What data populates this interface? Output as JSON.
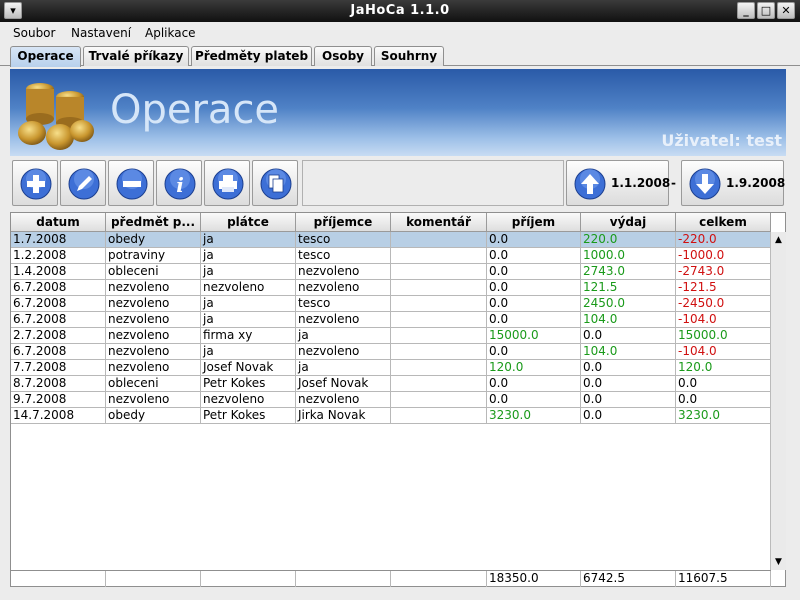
{
  "window": {
    "title": "JaHoCa 1.1.0"
  },
  "menu": [
    "Soubor",
    "Nastavení",
    "Aplikace"
  ],
  "tabs": [
    "Operace",
    "Trvalé příkazy",
    "Předměty plateb",
    "Osoby",
    "Souhrny"
  ],
  "banner": {
    "title": "Operace",
    "user": "Uživatel: test"
  },
  "toolbar": {
    "icons": [
      "plus-icon",
      "pencil-icon",
      "minus-icon",
      "info-icon",
      "printer-icon",
      "copy-icon"
    ],
    "date_from": "1.1.2008",
    "date_sep": "-",
    "date_to": "1.9.2008"
  },
  "table": {
    "columns": [
      "datum",
      "předmět p...",
      "plátce",
      "příjemce",
      "komentář",
      "příjem",
      "výdaj",
      "celkem"
    ],
    "rows": [
      [
        "1.7.2008",
        "obedy",
        "ja",
        "tesco",
        "",
        "0.0",
        "220.0",
        "-220.0"
      ],
      [
        "1.2.2008",
        "potraviny",
        "ja",
        "tesco",
        "",
        "0.0",
        "1000.0",
        "-1000.0"
      ],
      [
        "1.4.2008",
        "obleceni",
        "ja",
        "nezvoleno",
        "",
        "0.0",
        "2743.0",
        "-2743.0"
      ],
      [
        "6.7.2008",
        "nezvoleno",
        "nezvoleno",
        "nezvoleno",
        "",
        "0.0",
        "121.5",
        "-121.5"
      ],
      [
        "6.7.2008",
        "nezvoleno",
        "ja",
        "tesco",
        "",
        "0.0",
        "2450.0",
        "-2450.0"
      ],
      [
        "6.7.2008",
        "nezvoleno",
        "ja",
        "nezvoleno",
        "",
        "0.0",
        "104.0",
        "-104.0"
      ],
      [
        "2.7.2008",
        "nezvoleno",
        "firma xy",
        "ja",
        "",
        "15000.0",
        "0.0",
        "15000.0"
      ],
      [
        "6.7.2008",
        "nezvoleno",
        "ja",
        "nezvoleno",
        "",
        "0.0",
        "104.0",
        "-104.0"
      ],
      [
        "7.7.2008",
        "nezvoleno",
        "Josef Novak",
        "ja",
        "",
        "120.0",
        "0.0",
        "120.0"
      ],
      [
        "8.7.2008",
        "obleceni",
        "Petr Kokes",
        "Josef Novak",
        "",
        "0.0",
        "0.0",
        "0.0"
      ],
      [
        "9.7.2008",
        "nezvoleno",
        "nezvoleno",
        "nezvoleno",
        "",
        "0.0",
        "0.0",
        "0.0"
      ],
      [
        "14.7.2008",
        "obedy",
        "Petr Kokes",
        "Jirka Novak",
        "",
        "3230.0",
        "0.0",
        "3230.0"
      ]
    ],
    "selected_row": 0,
    "totals": [
      "",
      "",
      "",
      "",
      "",
      "18350.0",
      "6742.5",
      "11607.5"
    ]
  },
  "colors": {
    "positive": "#1a9a1a",
    "negative": "#d01010",
    "selection": "#b8cfe5"
  }
}
